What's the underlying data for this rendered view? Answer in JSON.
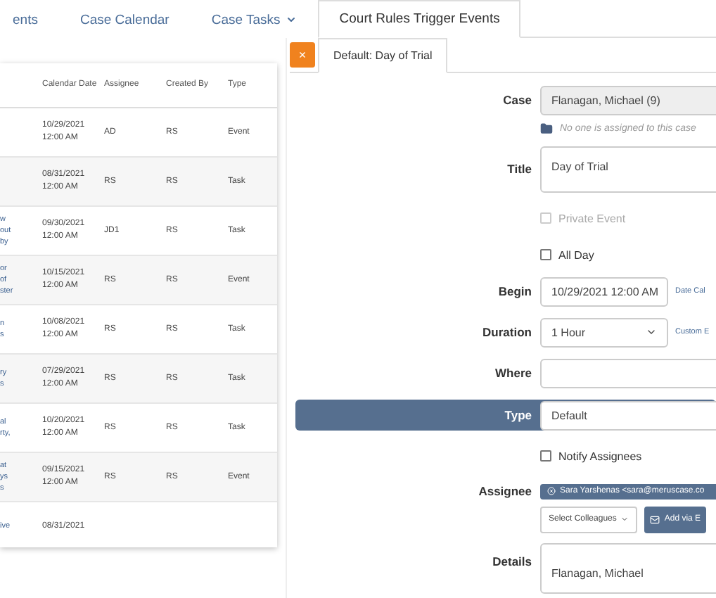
{
  "nav_tabs": [
    {
      "label": "ents",
      "kind": "link",
      "selected": false
    },
    {
      "label": "Case Calendar",
      "kind": "link",
      "selected": false
    },
    {
      "label": "Case Tasks",
      "kind": "dropdown",
      "selected": false
    },
    {
      "label": "Court Rules Trigger Events",
      "kind": "link",
      "selected": true
    }
  ],
  "table": {
    "columns": [
      "Calendar Date",
      "Assignee",
      "Created By",
      "Type"
    ],
    "rows": [
      {
        "column_1": [],
        "date": "10/29/2021",
        "time": "12:00 AM",
        "assignee": "AD",
        "created_by": "RS",
        "type": "Event"
      },
      {
        "column_1": [],
        "date": "08/31/2021",
        "time": "12:00 AM",
        "assignee": "RS",
        "created_by": "RS",
        "type": "Task"
      },
      {
        "column_1": [
          "w",
          "out",
          "by"
        ],
        "date": "09/30/2021",
        "time": "12:00 AM",
        "assignee": "JD1",
        "created_by": "RS",
        "type": "Task"
      },
      {
        "column_1": [
          "or",
          "of",
          "ster"
        ],
        "date": "10/15/2021",
        "time": "12:00 AM",
        "assignee": "RS",
        "created_by": "RS",
        "type": "Event"
      },
      {
        "column_1": [
          "n",
          "s"
        ],
        "date": "10/08/2021",
        "time": "12:00 AM",
        "assignee": "RS",
        "created_by": "RS",
        "type": "Task"
      },
      {
        "column_1": [
          "ry",
          "s"
        ],
        "date": "07/29/2021",
        "time": "12:00 AM",
        "assignee": "RS",
        "created_by": "RS",
        "type": "Task"
      },
      {
        "column_1": [
          "al",
          "rty,"
        ],
        "date": "10/20/2021",
        "time": "12:00 AM",
        "assignee": "RS",
        "created_by": "RS",
        "type": "Task"
      },
      {
        "column_1": [
          "at",
          "ys",
          "s"
        ],
        "date": "09/15/2021",
        "time": "12:00 AM",
        "assignee": "RS",
        "created_by": "RS",
        "type": "Event"
      },
      {
        "column_1": [
          "ive"
        ],
        "date": "08/31/2021",
        "time": "",
        "assignee": "",
        "created_by": "",
        "type": ""
      }
    ]
  },
  "editor": {
    "close_label": "×",
    "tab_label": "Default: Day of Trial",
    "case": {
      "label": "Case",
      "value": "Flanagan, Michael (9)",
      "hint": "No one is assigned to this case"
    },
    "title": {
      "label": "Title",
      "value": "Day of Trial"
    },
    "private_event": {
      "label": "Private Event",
      "checked": false,
      "disabled": true
    },
    "all_day": {
      "label": "All Day",
      "checked": false,
      "disabled": false
    },
    "begin": {
      "label": "Begin",
      "value": "10/29/2021 12:00 AM",
      "link": "Date Cal"
    },
    "duration": {
      "label": "Duration",
      "value": "1 Hour",
      "link": "Custom E"
    },
    "where": {
      "label": "Where"
    },
    "type": {
      "label": "Type",
      "value": "Default"
    },
    "notify": {
      "label": "Notify Assignees",
      "checked": false,
      "disabled": false
    },
    "assignee": {
      "label": "Assignee",
      "chip": "Sara Yarshenas <sara@meruscase.co",
      "select_button": "Select Colleagues",
      "add_button": "Add via E"
    },
    "details": {
      "label": "Details",
      "value": "Flanagan, Michael"
    }
  }
}
